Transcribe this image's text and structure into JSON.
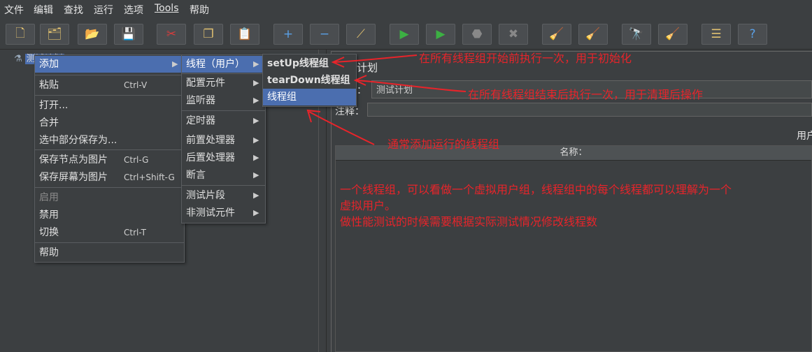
{
  "menubar": {
    "items": [
      "文件",
      "编辑",
      "查找",
      "运行",
      "选项",
      "Tools",
      "帮助"
    ]
  },
  "toolbar": {
    "buttons": [
      {
        "icon": "new-icon",
        "glyph": "🗋"
      },
      {
        "icon": "templates-icon",
        "glyph": "🗂"
      },
      {
        "icon": "open-icon",
        "glyph": "📂"
      },
      {
        "icon": "save-icon",
        "glyph": "💾"
      },
      {
        "icon": "cut-icon",
        "glyph": "✂"
      },
      {
        "icon": "copy-icon",
        "glyph": "❐"
      },
      {
        "icon": "paste-icon",
        "glyph": "📋"
      },
      {
        "icon": "expand-icon",
        "glyph": "+"
      },
      {
        "icon": "collapse-icon",
        "glyph": "−"
      },
      {
        "icon": "toggle-icon",
        "glyph": "⟋"
      },
      {
        "icon": "start-icon",
        "glyph": "▶"
      },
      {
        "icon": "start-no-pause-icon",
        "glyph": "▶"
      },
      {
        "icon": "stop-icon",
        "glyph": "⬣"
      },
      {
        "icon": "shutdown-icon",
        "glyph": "✖"
      },
      {
        "icon": "clear-icon",
        "glyph": "🧹"
      },
      {
        "icon": "clear-all-icon",
        "glyph": "🧹"
      },
      {
        "icon": "search-icon",
        "glyph": "🔭"
      },
      {
        "icon": "reset-search-icon",
        "glyph": "🧹"
      },
      {
        "icon": "function-helper-icon",
        "glyph": "☰"
      },
      {
        "icon": "help-icon",
        "glyph": "?"
      }
    ]
  },
  "tree": {
    "node_label": "测试计划"
  },
  "right_panel": {
    "title": "计划",
    "name_label": "：",
    "name_value": "测试计划",
    "comment_label": "注释：",
    "users_label": "用户",
    "table_header": "名称："
  },
  "context_menu": {
    "items": [
      {
        "label": "添加",
        "shortcut": "",
        "submenu": true,
        "highlight": true,
        "disabled": false
      },
      {
        "label": "粘贴",
        "shortcut": "Ctrl-V",
        "submenu": false,
        "highlight": false,
        "disabled": false
      },
      {
        "label": "打开...",
        "shortcut": "",
        "submenu": false,
        "highlight": false,
        "disabled": false
      },
      {
        "label": "合并",
        "shortcut": "",
        "submenu": false,
        "highlight": false,
        "disabled": false
      },
      {
        "label": "选中部分保存为...",
        "shortcut": "",
        "submenu": false,
        "highlight": false,
        "disabled": false
      },
      {
        "label": "保存节点为图片",
        "shortcut": "Ctrl-G",
        "submenu": false,
        "highlight": false,
        "disabled": false
      },
      {
        "label": "保存屏幕为图片",
        "shortcut": "Ctrl+Shift-G",
        "submenu": false,
        "highlight": false,
        "disabled": false
      },
      {
        "label": "启用",
        "shortcut": "",
        "submenu": false,
        "highlight": false,
        "disabled": true
      },
      {
        "label": "禁用",
        "shortcut": "",
        "submenu": false,
        "highlight": false,
        "disabled": false
      },
      {
        "label": "切换",
        "shortcut": "Ctrl-T",
        "submenu": false,
        "highlight": false,
        "disabled": false
      },
      {
        "label": "帮助",
        "shortcut": "",
        "submenu": false,
        "highlight": false,
        "disabled": false
      }
    ]
  },
  "add_submenu": {
    "items": [
      {
        "label": "线程（用户）",
        "highlight": true
      },
      {
        "label": "配置元件",
        "highlight": false
      },
      {
        "label": "监听器",
        "highlight": false
      },
      {
        "label": "定时器",
        "highlight": false
      },
      {
        "label": "前置处理器",
        "highlight": false
      },
      {
        "label": "后置处理器",
        "highlight": false
      },
      {
        "label": "断言",
        "highlight": false
      },
      {
        "label": "测试片段",
        "highlight": false
      },
      {
        "label": "非测试元件",
        "highlight": false
      }
    ]
  },
  "thread_submenu": {
    "items": [
      {
        "label": "setUp线程组",
        "highlight": false
      },
      {
        "label": "tearDown线程组",
        "highlight": false
      },
      {
        "label": "线程组",
        "highlight": true
      }
    ]
  },
  "annotations": {
    "setup_note": "在所有线程组开始前执行一次，用于初始化",
    "teardown_note": "在所有线程组结束后执行一次，用于清理后操作",
    "threadgroup_note": "通常添加运行的线程组",
    "desc_line1": "一个线程组，可以看做一个虚拟用户组，线程组中的每个线程都可以理解为一个",
    "desc_line2": "虚拟用户。",
    "desc_line3": "做性能测试的时候需要根据实际测试情况修改线程数"
  },
  "colors": {
    "background": "#3c3f41",
    "highlight": "#4b6eaf",
    "annotation": "#e8242a"
  }
}
